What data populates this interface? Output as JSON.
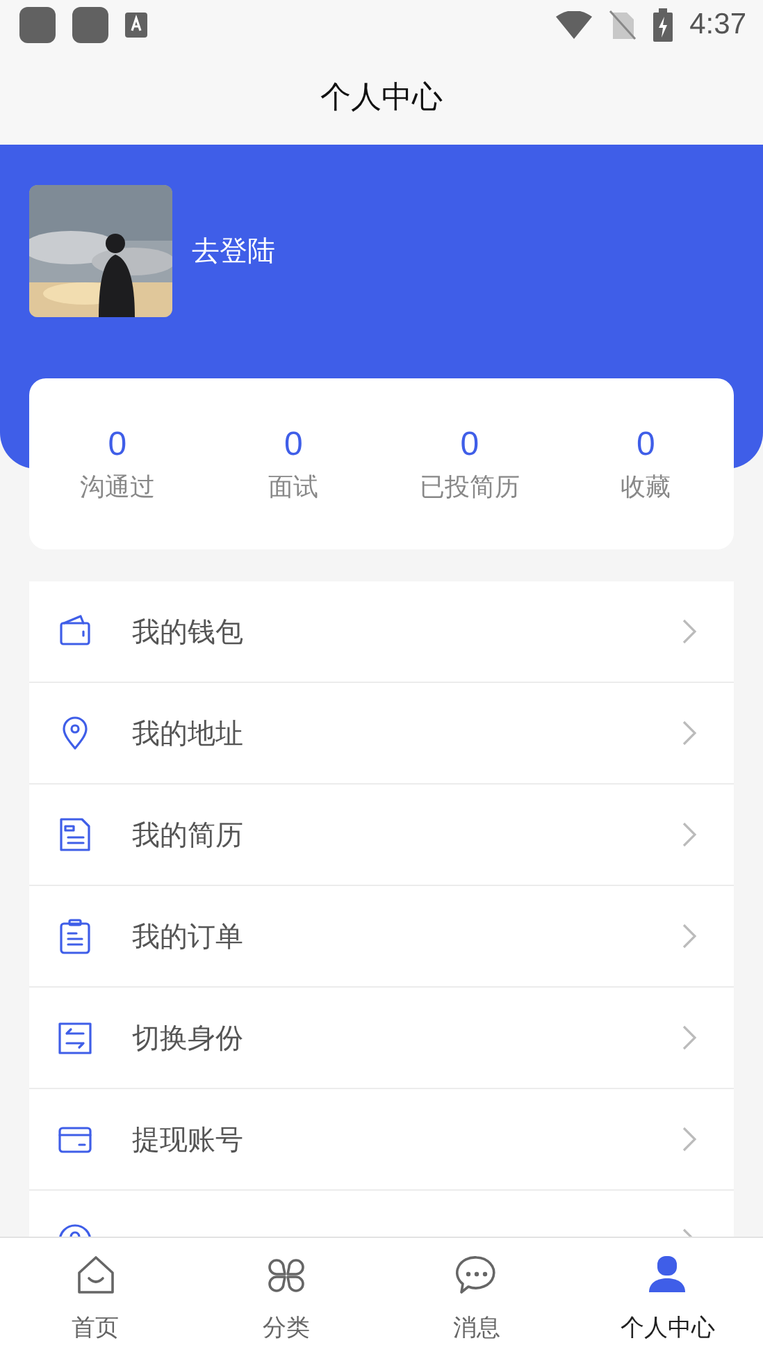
{
  "status_bar": {
    "time": "4:37"
  },
  "header": {
    "title": "个人中心"
  },
  "profile": {
    "login_label": "去登陆"
  },
  "stats": [
    {
      "value": "0",
      "label": "沟通过"
    },
    {
      "value": "0",
      "label": "面试"
    },
    {
      "value": "0",
      "label": "已投简历"
    },
    {
      "value": "0",
      "label": "收藏"
    }
  ],
  "menu": [
    {
      "kind": "wallet",
      "label": "我的钱包"
    },
    {
      "kind": "location",
      "label": "我的地址"
    },
    {
      "kind": "resume",
      "label": "我的简历"
    },
    {
      "kind": "order",
      "label": "我的订单"
    },
    {
      "kind": "switch",
      "label": "切换身份"
    },
    {
      "kind": "card",
      "label": "提现账号"
    },
    {
      "kind": "privacy"
    }
  ],
  "tab_bar": [
    {
      "kind": "home",
      "label": "首页",
      "selected": false
    },
    {
      "kind": "category",
      "label": "分类",
      "selected": false
    },
    {
      "kind": "message",
      "label": "消息",
      "selected": false
    },
    {
      "kind": "profile",
      "label": "个人中心",
      "selected": true
    }
  ]
}
